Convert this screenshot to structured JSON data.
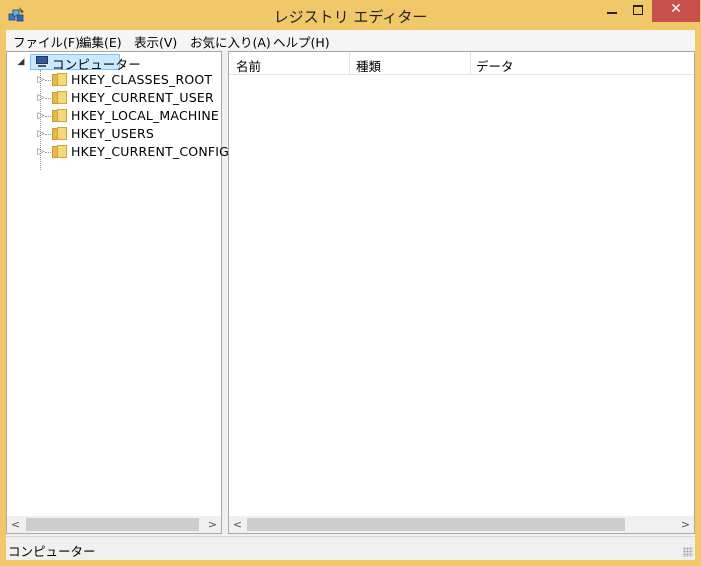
{
  "window": {
    "title": "レジストリ エディター",
    "close_glyph": "✕"
  },
  "menu": [
    "ファイル(F)",
    "編集(E)",
    "表示(V)",
    "お気に入り(A)",
    "ヘルプ(H)"
  ],
  "tree": {
    "root_label": "コンピューター",
    "root_expander": "◢",
    "child_expander": "▷",
    "items": [
      "HKEY_CLASSES_ROOT",
      "HKEY_CURRENT_USER",
      "HKEY_LOCAL_MACHINE",
      "HKEY_USERS",
      "HKEY_CURRENT_CONFIG"
    ]
  },
  "list": {
    "columns": [
      "名前",
      "種類",
      "データ"
    ]
  },
  "scroll": {
    "left_arrow": "<",
    "right_arrow": ">"
  },
  "status": {
    "text": "コンピューター"
  },
  "icons": {
    "app": "registry-editor-icon",
    "computer": "computer-icon",
    "folder": "folder-icon"
  }
}
